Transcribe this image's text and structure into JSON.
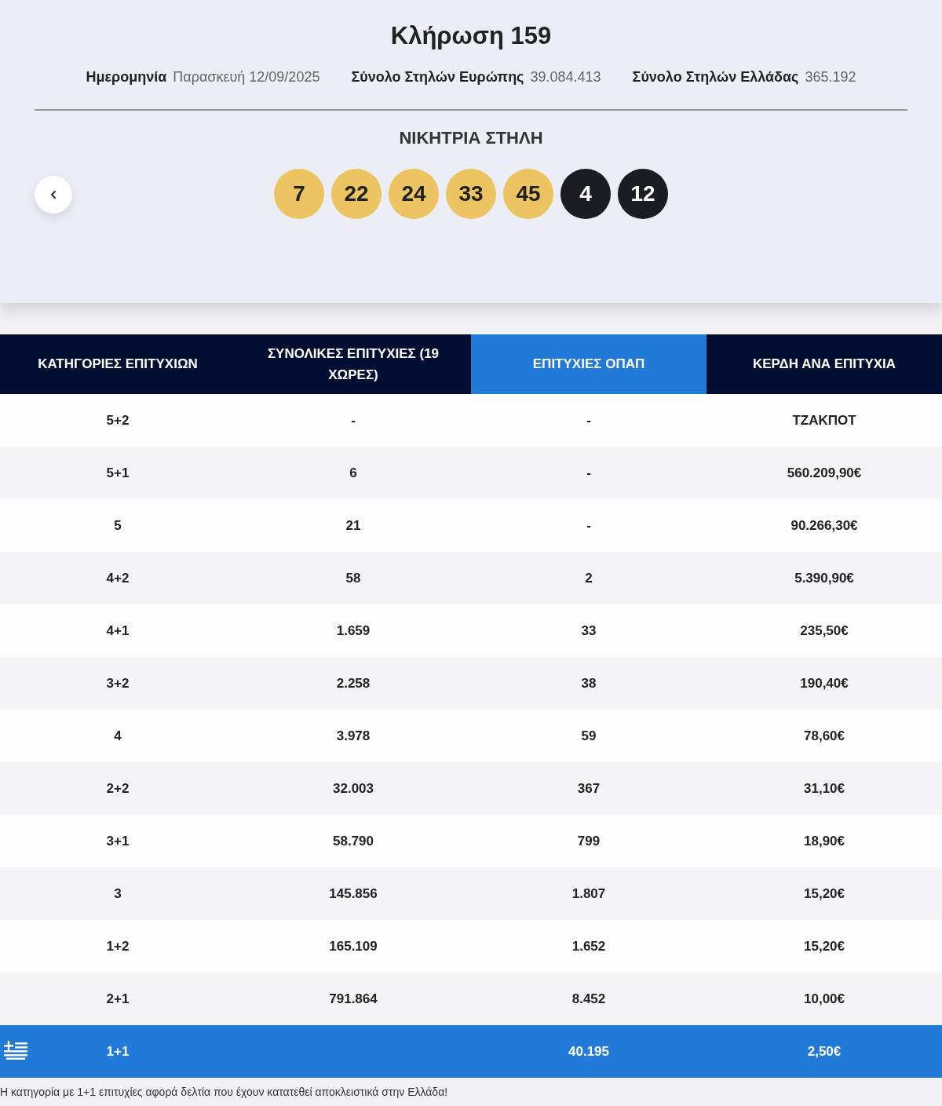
{
  "draw": {
    "title": "Κλήρωση 159",
    "meta": [
      {
        "label": "Ημερομηνία",
        "value": "Παρασκευή 12/09/2025"
      },
      {
        "label": "Σύνολο Στηλών Ευρώπης",
        "value": "39.084.413"
      },
      {
        "label": "Σύνολο Στηλών Ελλάδας",
        "value": "365.192"
      }
    ],
    "winning_heading": "ΝΙΚΗΤΡΙΑ ΣΤΗΛΗ",
    "balls": [
      {
        "number": "7",
        "kind": "main"
      },
      {
        "number": "22",
        "kind": "main"
      },
      {
        "number": "24",
        "kind": "main"
      },
      {
        "number": "33",
        "kind": "main"
      },
      {
        "number": "45",
        "kind": "main"
      },
      {
        "number": "4",
        "kind": "star"
      },
      {
        "number": "12",
        "kind": "star"
      }
    ]
  },
  "table": {
    "columns": [
      {
        "label": "ΚΑΤΗΓΟΡΙΕΣ ΕΠΙΤΥΧΙΩΝ",
        "selected": false
      },
      {
        "label": "ΣΥΝΟΛΙΚΕΣ ΕΠΙΤΥΧΙΕΣ (19 ΧΩΡΕΣ)",
        "selected": false
      },
      {
        "label": "ΕΠΙΤΥΧΙΕΣ ΟΠΑΠ",
        "selected": true
      },
      {
        "label": "ΚΕΡΔΗ ΑΝΑ ΕΠΙΤΥΧΙΑ",
        "selected": false
      }
    ],
    "rows": [
      {
        "kind": "normal",
        "cells": [
          "5+2",
          "-",
          "-",
          "ΤΖΑΚΠΟΤ"
        ]
      },
      {
        "kind": "normal",
        "cells": [
          "5+1",
          "6",
          "-",
          "560.209,90€"
        ]
      },
      {
        "kind": "normal",
        "cells": [
          "5",
          "21",
          "-",
          "90.266,30€"
        ]
      },
      {
        "kind": "normal",
        "cells": [
          "4+2",
          "58",
          "2",
          "5.390,90€"
        ]
      },
      {
        "kind": "normal",
        "cells": [
          "4+1",
          "1.659",
          "33",
          "235,50€"
        ]
      },
      {
        "kind": "normal",
        "cells": [
          "3+2",
          "2.258",
          "38",
          "190,40€"
        ]
      },
      {
        "kind": "normal",
        "cells": [
          "4",
          "3.978",
          "59",
          "78,60€"
        ]
      },
      {
        "kind": "normal",
        "cells": [
          "2+2",
          "32.003",
          "367",
          "31,10€"
        ]
      },
      {
        "kind": "normal",
        "cells": [
          "3+1",
          "58.790",
          "799",
          "18,90€"
        ]
      },
      {
        "kind": "normal",
        "cells": [
          "3",
          "145.856",
          "1.807",
          "15,20€"
        ]
      },
      {
        "kind": "normal",
        "cells": [
          "1+2",
          "165.109",
          "1.652",
          "15,20€"
        ]
      },
      {
        "kind": "normal",
        "cells": [
          "2+1",
          "791.864",
          "8.452",
          "10,00€"
        ]
      },
      {
        "kind": "greece",
        "cells": [
          "1+1",
          "",
          "40.195",
          "2,50€"
        ]
      }
    ]
  },
  "note": "Η κατηγορία με 1+1 επιτυχίες αφορά δελτία που έχουν κατατεθεί αποκλειστικά στην Ελλάδα!"
}
